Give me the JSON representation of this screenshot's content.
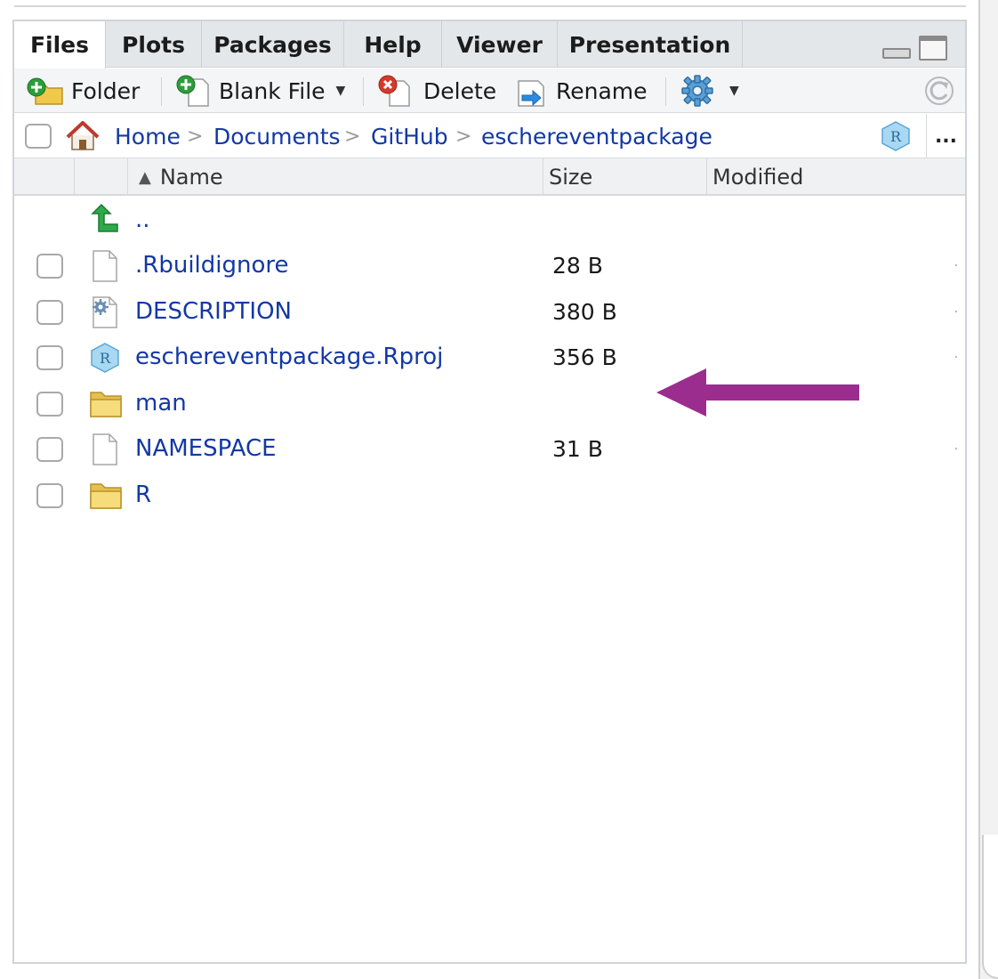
{
  "tabs": [
    {
      "label": "Files",
      "active": true
    },
    {
      "label": "Plots",
      "active": false
    },
    {
      "label": "Packages",
      "active": false
    },
    {
      "label": "Help",
      "active": false
    },
    {
      "label": "Viewer",
      "active": false
    },
    {
      "label": "Presentation",
      "active": false
    }
  ],
  "toolbar": {
    "new_folder": "Folder",
    "blank_file": "Blank File",
    "delete": "Delete",
    "rename": "Rename"
  },
  "breadcrumb": {
    "items": [
      "Home",
      "Documents",
      "GitHub",
      "eschereventpackage"
    ],
    "separator": ">",
    "more": "..."
  },
  "columns": {
    "name": "Name",
    "size": "Size",
    "modified": "Modified",
    "sort_indicator": "▲"
  },
  "parent_link": "..",
  "files": [
    {
      "name": ".Rbuildignore",
      "size": "28 B",
      "icon": "text-file-icon"
    },
    {
      "name": "DESCRIPTION",
      "size": "380 B",
      "icon": "description-file-icon"
    },
    {
      "name": "eschereventpackage.Rproj",
      "size": "356 B",
      "icon": "rproject-icon"
    },
    {
      "name": "man",
      "size": "",
      "icon": "folder-icon"
    },
    {
      "name": "NAMESPACE",
      "size": "31 B",
      "icon": "text-file-icon"
    },
    {
      "name": "R",
      "size": "",
      "icon": "folder-icon"
    }
  ],
  "colors": {
    "link": "#1338a6",
    "annotation_arrow": "#9b2d8f",
    "tab_bar": "#e4e7ea"
  }
}
